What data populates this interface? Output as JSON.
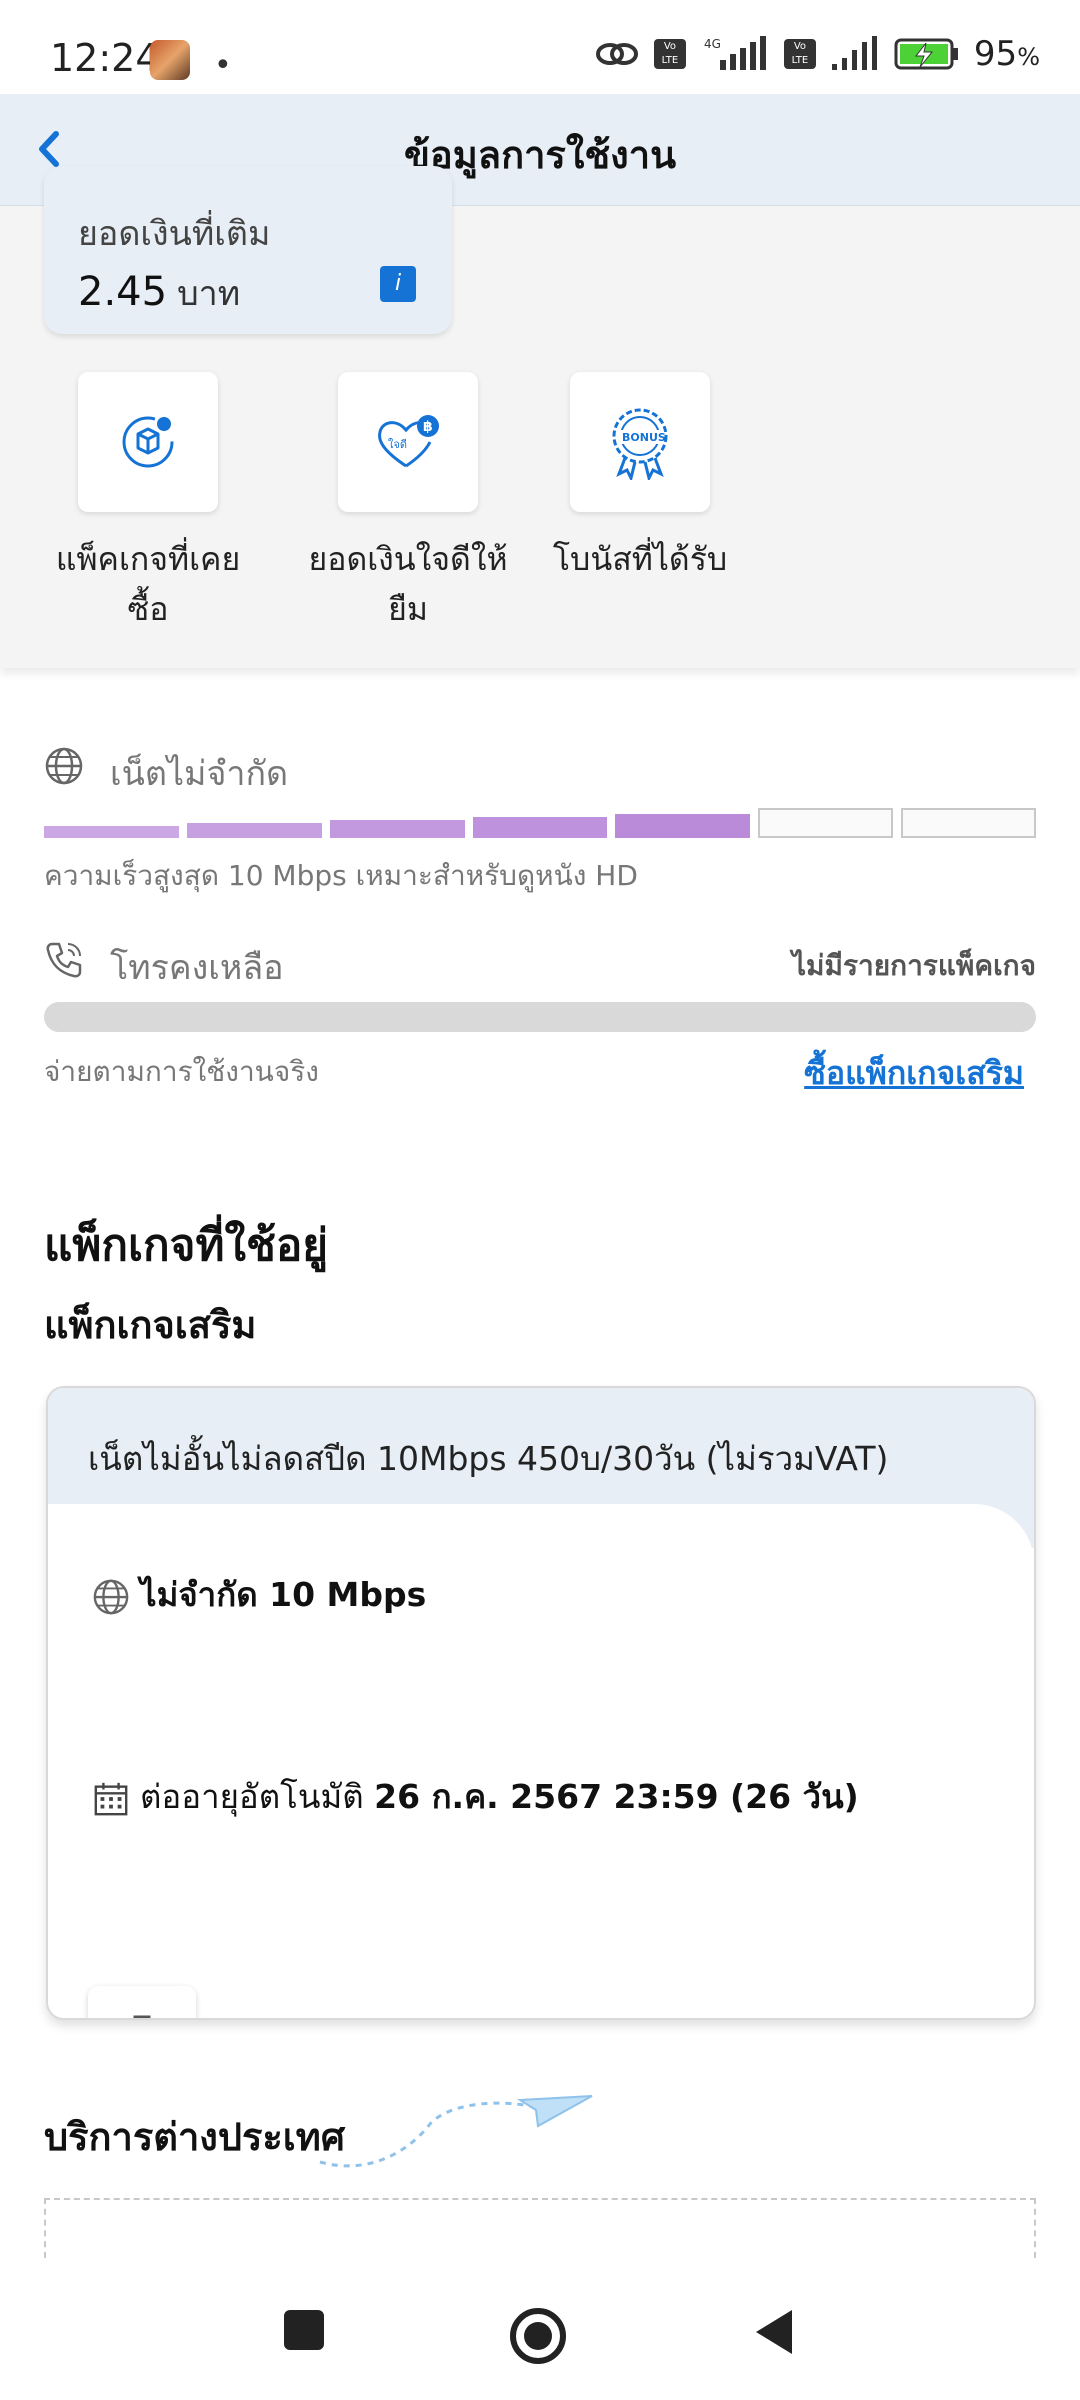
{
  "status_bar": {
    "time": "12:24",
    "network": "4G",
    "battery": "95",
    "battery_unit": "%"
  },
  "app_bar": {
    "title": "ข้อมูลการใช้งาน"
  },
  "balance": {
    "label": "ยอดเงินที่เติม",
    "amount": "2.45",
    "unit": "บาท"
  },
  "quick_actions": [
    {
      "label": "แพ็คเกจที่เคยซื้อ",
      "icon": "package-history-icon"
    },
    {
      "label": "ยอดเงินใจดีให้ยืม",
      "icon": "heart-loan-icon"
    },
    {
      "label": "โบนัสที่ได้รับ",
      "icon": "bonus-badge-icon"
    }
  ],
  "internet": {
    "title": "เน็ตไม่จำกัด",
    "description": "ความเร็วสูงสุด 10 Mbps เหมาะสำหรับดูหนัง HD",
    "signal_level": 5,
    "signal_max": 7,
    "accent": "#b98ad9"
  },
  "calls": {
    "title": "โทรคงเหลือ",
    "status": "ไม่มีรายการแพ็คเกจ",
    "description": "จ่ายตามการใช้งานจริง",
    "buy_link": "ซื้อแพ็กเกจเสริม"
  },
  "active_packages": {
    "heading": "แพ็กเกจที่ใช้อยู่",
    "subheading": "แพ็กเกจเสริม",
    "package": {
      "name": "เน็ตไม่อั้นไม่ลดสปีด 10Mbps 450บ/30วัน (ไม่รวมVAT)",
      "feature": "ไม่จำกัด 10 Mbps",
      "renew_label": "ต่ออายุอัตโนมัติ",
      "renew_date": "26 ก.ค. 2567 23:59 (26 วัน)"
    }
  },
  "international": {
    "heading": "บริการต่างประเทศ"
  },
  "colors": {
    "accent_blue": "#1673d6",
    "app_bar_bg": "#e7eef5"
  }
}
